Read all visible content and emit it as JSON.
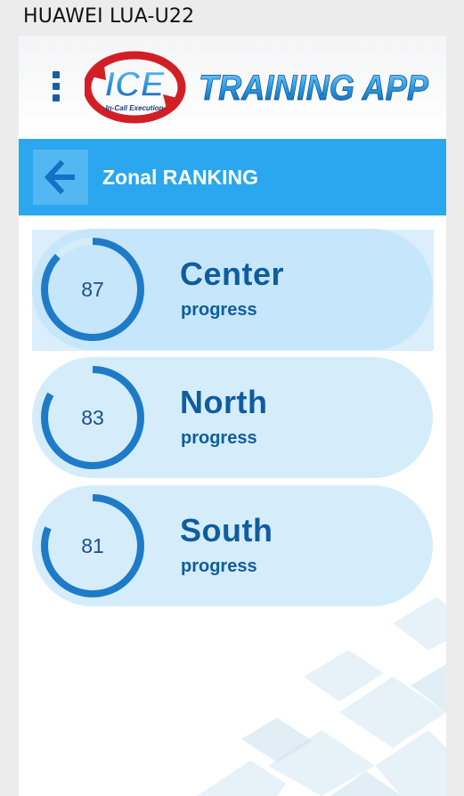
{
  "device": {
    "label": "HUAWEI LUA-U22"
  },
  "header": {
    "logo_main": "ICE",
    "logo_tagline": "In-Call Execution",
    "app_name": "TRAINING APP"
  },
  "titlebar": {
    "title": "Zonal RANKING"
  },
  "colors": {
    "accent": "#2aa7ef",
    "ring": "#1e7bc8",
    "text": "#0f5d9f",
    "card": "#d5edfb"
  },
  "rankings": [
    {
      "zone": "Center",
      "sub": "progress",
      "value": "87",
      "percent": 87
    },
    {
      "zone": "North",
      "sub": "progress",
      "value": "83",
      "percent": 83
    },
    {
      "zone": "South",
      "sub": "progress",
      "value": "81",
      "percent": 81
    }
  ]
}
